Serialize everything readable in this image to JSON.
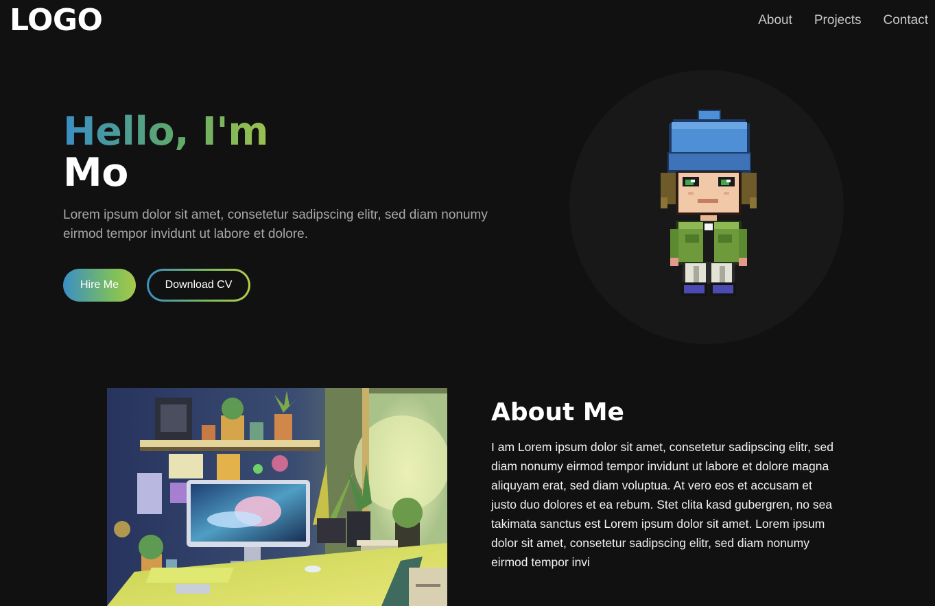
{
  "header": {
    "logo": "LOGO",
    "nav": [
      "About",
      "Projects",
      "Contact"
    ]
  },
  "hero": {
    "greeting": "Hello, I'm",
    "name": "Mo",
    "description": "Lorem ipsum dolor sit amet, consetetur sadipscing elitr, sed diam nonumy eirmod tempor invidunt ut labore et dolore.",
    "hire_label": "Hire Me",
    "cv_label": "Download CV",
    "avatar": "pixel-art-character-icon"
  },
  "about": {
    "title": "About Me",
    "text": "I am Lorem ipsum dolor sit amet, consetetur sadipscing elitr, sed diam nonumy eirmod tempor invidunt ut labore et dolore magna aliquyam erat, sed diam voluptua. At vero eos et accusam et justo duo dolores et ea rebum. Stet clita kasd gubergren, no sea takimata sanctus est Lorem ipsum dolor sit amet. Lorem ipsum dolor sit amet, consetetur sadipscing elitr, sed diam nonumy eirmod tempor invi",
    "image": "workspace-illustration"
  },
  "colors": {
    "background": "#111111",
    "gradient_start": "#3a8fc4",
    "gradient_end": "#a7c84c",
    "avatar_circle": "#181818"
  }
}
